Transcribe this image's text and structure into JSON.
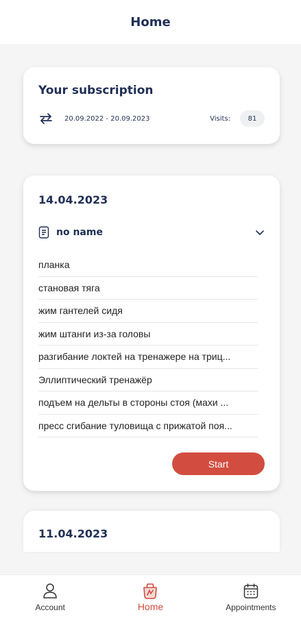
{
  "header": {
    "title": "Home"
  },
  "subscription": {
    "title": "Your subscription",
    "dates": "20.09.2022 - 20.09.2023",
    "visits_label": "Visits:",
    "visits_count": "81"
  },
  "workout": {
    "date": "14.04.2023",
    "plan_name": "no name",
    "exercises": [
      "планка",
      "становая тяга",
      "жим гантелей сидя",
      "жим штанги из-за головы",
      "разгибание локтей на тренажере на триц...",
      "Эллиптический тренажёр",
      "подъем на дельты в стороны стоя (махи ...",
      "пресс сгибание туловища с прижатой поя..."
    ],
    "start_label": "Start"
  },
  "next_workout": {
    "date": "11.04.2023"
  },
  "nav": {
    "items": [
      {
        "label": "Account",
        "icon": "person-icon"
      },
      {
        "label": "Home",
        "icon": "fitness-icon",
        "active": true
      },
      {
        "label": "Appointments",
        "icon": "calendar-icon"
      }
    ]
  },
  "colors": {
    "accent": "#d24d40",
    "primary_text": "#1f2f55",
    "background": "#f5f5f5"
  }
}
